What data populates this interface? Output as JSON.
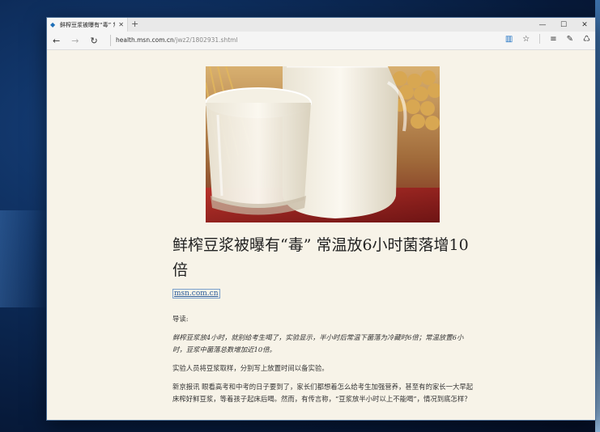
{
  "tab": {
    "title": "鲜榨豆浆被曝有“毒” 常温",
    "close": "✕",
    "new_tab": "+"
  },
  "window_controls": {
    "minimize": "—",
    "maximize": "☐",
    "close": "✕"
  },
  "nav": {
    "back": "←",
    "forward": "→",
    "refresh": "↻"
  },
  "address": {
    "host": "health.msn.com.cn",
    "path": "/jwz2/1802931.shtml"
  },
  "toolbar_icons": [
    "reading-view",
    "favorites-star",
    "hub",
    "web-note",
    "share"
  ],
  "article": {
    "title": "鲜榨豆浆被曝有“毒” 常温放6小时菌落增10倍",
    "source": "msn.com.cn",
    "intro_label": "导读:",
    "lead": "鲜榨豆浆放4小时，就别给考生喝了，实验显示，半小时后常温下菌落为冷藏时6倍；常温放置6小时，豆浆中菌落总数增加近10倍。",
    "para1": "实验人员将豆浆取样，分别写上放置时间以备实验。",
    "para2": "新京报讯 眼看高考和中考的日子要到了，家长们都想着怎么给考生加强营养，甚至有的家长一大早起床榨好鲜豆浆，等着孩子起床后喝。然而，有传言称，“豆浆放半小时以上不能喝”，情况到底怎样？"
  }
}
